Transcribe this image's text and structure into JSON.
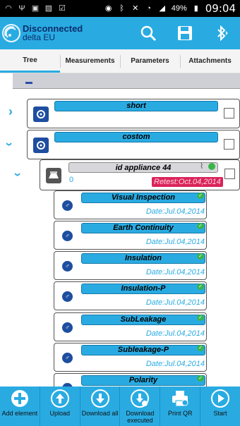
{
  "status_bar": {
    "battery": "49%",
    "time": "09:04"
  },
  "header": {
    "title_line1": "Disconnected",
    "title_line2": "delta EU"
  },
  "tabs": [
    {
      "label": "Tree",
      "active": true
    },
    {
      "label": "Measurements",
      "active": false
    },
    {
      "label": "Parameters",
      "active": false
    },
    {
      "label": "Attachments",
      "active": false
    }
  ],
  "tree": {
    "nodes": [
      {
        "name": "short",
        "expanded": false
      },
      {
        "name": "costom",
        "expanded": true
      }
    ],
    "appliance": {
      "name": "id appliance 44",
      "count": "0",
      "retest": "Retest:Oct.04,2014"
    },
    "tests": [
      {
        "name": "Visual Inspection",
        "date": "Date:Jul.04,2014"
      },
      {
        "name": "Earth Continuity",
        "date": "Date:Jul.04,2014"
      },
      {
        "name": "Insulation",
        "date": "Date:Jul.04,2014"
      },
      {
        "name": "Insulation-P",
        "date": "Date:Jul.04,2014"
      },
      {
        "name": "SubLeakage",
        "date": "Date:Jul.04,2014"
      },
      {
        "name": "Subleakage-P",
        "date": "Date:Jul.04,2014"
      },
      {
        "name": "Polarity",
        "date": ""
      }
    ]
  },
  "toolbar": [
    {
      "label": "Add element",
      "icon": "plus-circle-icon"
    },
    {
      "label": "Upload",
      "icon": "upload-arrow-icon"
    },
    {
      "label": "Download all",
      "icon": "download-arrow-icon"
    },
    {
      "label": "Download executed",
      "icon": "download-executed-icon"
    },
    {
      "label": "Print QR",
      "icon": "printer-icon"
    },
    {
      "label": "Start",
      "icon": "play-icon"
    }
  ],
  "colors": {
    "accent": "#29abe2",
    "retest": "#d9245a",
    "pass": "#39b54a"
  }
}
